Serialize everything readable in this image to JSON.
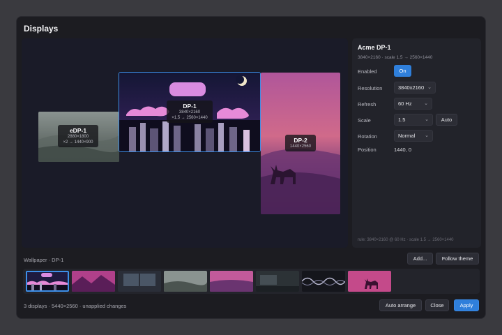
{
  "window": {
    "title": "Displays"
  },
  "displays": [
    {
      "name": "eDP-1",
      "resolution": "2880×1800",
      "mapping": "×2 → 1440×900"
    },
    {
      "name": "DP-1",
      "resolution": "3840×2160",
      "mapping": "×1.5 → 2560×1440"
    },
    {
      "name": "DP-2",
      "resolution": "1440×2560"
    }
  ],
  "panel": {
    "title": "Acme DP-1",
    "subtitle": "3840×2160 · scale 1.5 → 2560×1440",
    "enabled_label": "Enabled",
    "enabled_value": "On",
    "resolution_label": "Resolution",
    "resolution_value": "3840x2160",
    "refresh_label": "Refresh",
    "refresh_value": "60 Hz",
    "scale_label": "Scale",
    "scale_value": "1.5",
    "scale_auto": "Auto",
    "rotation_label": "Rotation",
    "rotation_value": "Normal",
    "position_label": "Position",
    "position_value": "1440, 0",
    "rule": "rule: 3840×2160 @ 60 Hz · scale 1.5 → 2560×1440"
  },
  "wallpaper": {
    "label": "Wallpaper · DP-1",
    "add_label": "Add...",
    "follow_label": "Follow theme",
    "thumbnails": [
      "synthwave-city",
      "magenta-mountains",
      "dim-window",
      "misty-valley",
      "purple-lake",
      "dark-room",
      "silver-waves",
      "deer-silhouette"
    ]
  },
  "footer": {
    "status": "3 displays · 5440×2560 · unapplied changes",
    "auto_arrange": "Auto arrange",
    "close": "Close",
    "apply": "Apply"
  },
  "colors": {
    "accent": "#2f7fdb",
    "background": "#1c1c21"
  }
}
